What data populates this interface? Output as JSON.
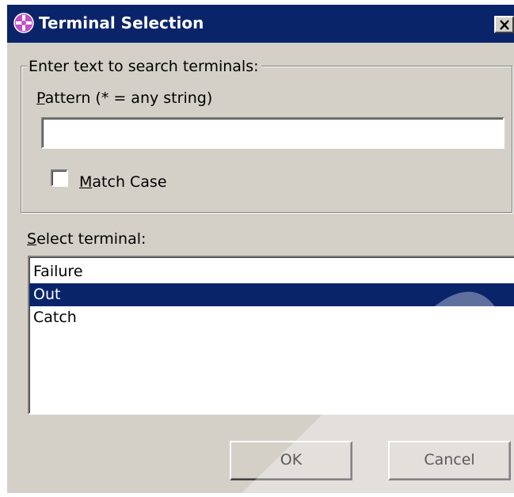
{
  "dialog": {
    "title": "Terminal Selection",
    "colors": {
      "titlebar": "#0a246a",
      "face": "#d4d0c8",
      "selection": "#0a246a"
    }
  },
  "search_group": {
    "legend": "Enter text to search terminals:",
    "pattern_label_mnemonic": "P",
    "pattern_label_rest": "attern (* = any string)",
    "pattern_value": "",
    "match_case_mnemonic": "M",
    "match_case_rest": "atch Case",
    "match_case_checked": false
  },
  "terminals": {
    "label_mnemonic": "S",
    "label_rest": "elect terminal:",
    "items": [
      {
        "label": "Failure",
        "selected": false
      },
      {
        "label": "Out",
        "selected": true
      },
      {
        "label": "Catch",
        "selected": false
      }
    ]
  },
  "buttons": {
    "ok": "OK",
    "cancel": "Cancel"
  },
  "icons": {
    "title": "terminal-selection-icon",
    "close": "close-icon"
  }
}
